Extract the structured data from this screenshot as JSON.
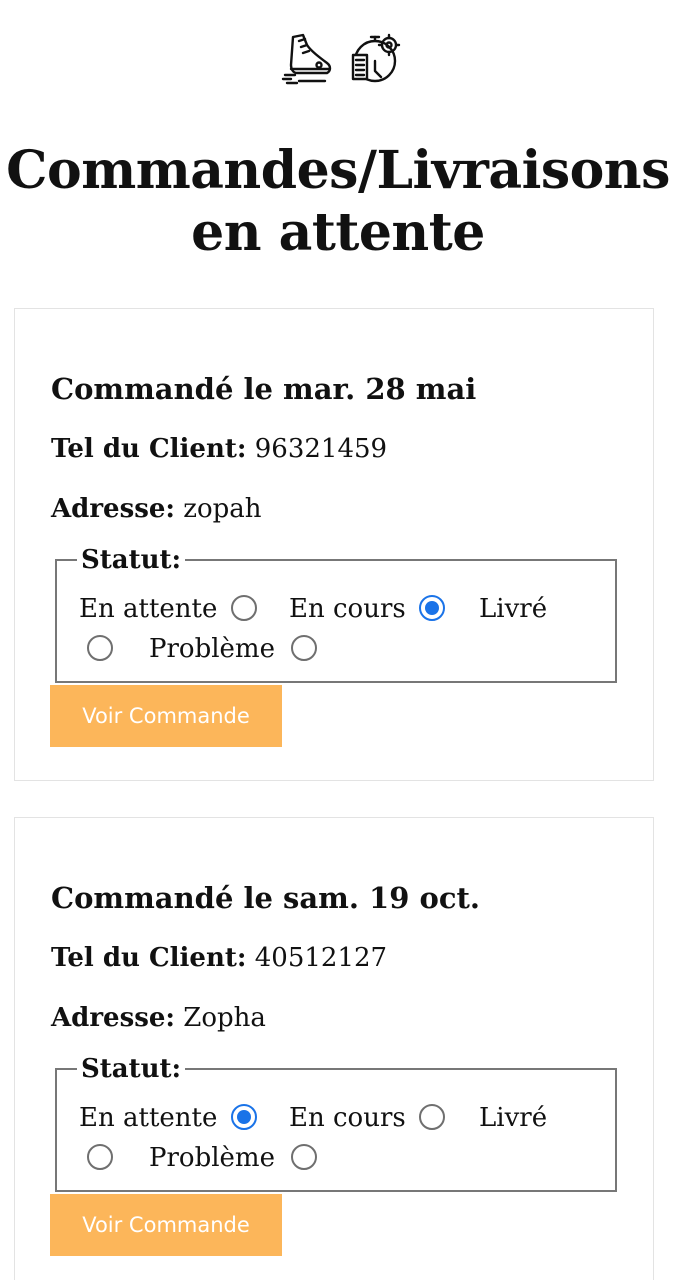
{
  "header": {
    "icons": [
      "running-shoe-icon",
      "delivery-clock-gear-icon"
    ],
    "title_line1": "Commandes/Livraisons",
    "title_line2": "en attente"
  },
  "orders": [
    {
      "date": "Commandé le mar. 28 mai",
      "tel_label": "Tel du Client:",
      "tel_value": "96321459",
      "address_label": "Adresse:",
      "address_value": "zopah",
      "status_legend": "Statut:",
      "options": [
        "En attente",
        "En cours",
        "Livré",
        "Problème"
      ],
      "selected": "En cours",
      "button_label": "Voir Commande"
    },
    {
      "date": "Commandé le sam. 19 oct.",
      "tel_label": "Tel du Client:",
      "tel_value": "40512127",
      "address_label": "Adresse:",
      "address_value": "Zopha",
      "status_legend": "Statut:",
      "options": [
        "En attente",
        "En cours",
        "Livré",
        "Problème"
      ],
      "selected": "En attente",
      "button_label": "Voir Commande"
    }
  ],
  "colors": {
    "button_bg": "#fcb65a",
    "radio_checked": "#1a73e8",
    "fieldset_border": "#777777",
    "card_border": "#e3e3e3"
  }
}
